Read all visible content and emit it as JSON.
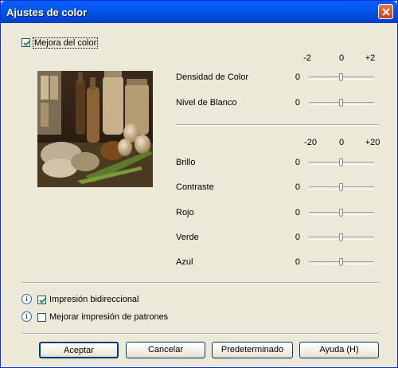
{
  "window": {
    "title": "Ajustes de color"
  },
  "color_enhance": {
    "label": "Mejora del color",
    "checked": true
  },
  "group1": {
    "scale": [
      "-2",
      "0",
      "+2"
    ],
    "rows": [
      {
        "label": "Densidad de Color",
        "value": "0",
        "level": 0
      },
      {
        "label": "Nivel de Blanco",
        "value": "0",
        "level": 0
      }
    ]
  },
  "group2": {
    "scale": [
      "-20",
      "0",
      "+20"
    ],
    "rows": [
      {
        "label": "Brillo",
        "value": "0",
        "level": 0
      },
      {
        "label": "Contraste",
        "value": "0",
        "level": 0
      },
      {
        "label": "Rojo",
        "value": "0",
        "level": 0
      },
      {
        "label": "Verde",
        "value": "0",
        "level": 0
      },
      {
        "label": "Azul",
        "value": "0",
        "level": 0
      }
    ]
  },
  "options": {
    "bidirectional": {
      "label": "Impresión bidireccional",
      "checked": true
    },
    "pattern": {
      "label": "Mejorar impresión de patrones",
      "checked": false
    }
  },
  "buttons": {
    "ok": "Aceptar",
    "cancel": "Cancelar",
    "default": "Predeterminado",
    "help": "Ayuda (H)"
  },
  "icons": {
    "close": "close-icon",
    "info": "info-icon",
    "check": "checkmark-icon"
  },
  "colors": {
    "titlebar": "#0058ee",
    "face": "#ece9d8",
    "close": "#c8401a"
  }
}
